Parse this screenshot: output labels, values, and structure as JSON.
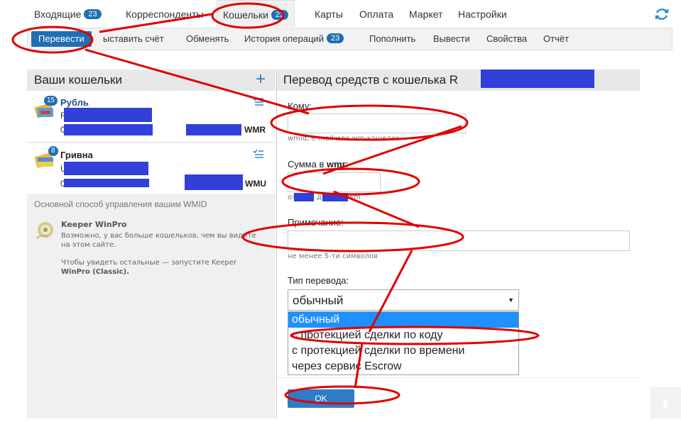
{
  "topnav": {
    "tabs": [
      {
        "label": "Входящие",
        "badge": "23"
      },
      {
        "label": "Корреспонденты"
      },
      {
        "label": "Кошельки",
        "badge": "23"
      },
      {
        "label": "Карты"
      },
      {
        "label": "Оплата"
      },
      {
        "label": "Маркет"
      },
      {
        "label": "Настройки"
      }
    ],
    "refresh_icon": "refresh-icon"
  },
  "subnav": {
    "items": [
      {
        "label": "Перевести"
      },
      {
        "label": "ыставить счёт"
      },
      {
        "label": "Обменять"
      },
      {
        "label": "История операций",
        "badge": "23"
      },
      {
        "label": "Пополнить"
      },
      {
        "label": "Вывести"
      },
      {
        "label": "Свойства"
      },
      {
        "label": "Отчёт"
      }
    ]
  },
  "left": {
    "title": "Ваши кошельки",
    "wallets": [
      {
        "badge": "15",
        "name": "Рубль",
        "line1_char": "R",
        "line2_char": "0",
        "currency": "WMR"
      },
      {
        "badge": "8",
        "name": "Гривна",
        "line1_char": "U",
        "line2_char": "0",
        "currency": "WMU"
      }
    ],
    "wmid_note": "Основной способ управления вашим WMID",
    "keeper": {
      "title": "Keeper WinPro",
      "text1a": "Возможно, у вас больше кошельков, чем вы видите",
      "text1b": "на этом сайте.",
      "text2a": "Чтобы увидеть остальные — запустите Keeper",
      "text2b": "WinPro (Classic)."
    }
  },
  "right": {
    "title": "Перевод средств с кошелька R",
    "to_label": "Кому:",
    "to_hint": "wmid, e-mail или wm-кошелек",
    "amount_label_pre": "Сумма в ",
    "amount_label_bold": "wmr",
    "amount_label_post": ":",
    "amount_hint_a": "от",
    "amount_hint_b": "д",
    "amount_hint_c": "wm",
    "note_label": "Примечание:",
    "note_hint": "не менее 5-ти символов",
    "type_label": "Тип перевода:",
    "type_selected": "обычный",
    "type_options": [
      "обычный",
      "с протекцией сделки по коду",
      "с протекцией сделки по времени",
      "через сервис Escrow"
    ],
    "ok_label": "OK"
  },
  "colors": {
    "accent": "#1f6fb4",
    "redaction": "#3040d8",
    "annotation": "#e00000",
    "option_highlight": "#1e90ff"
  }
}
